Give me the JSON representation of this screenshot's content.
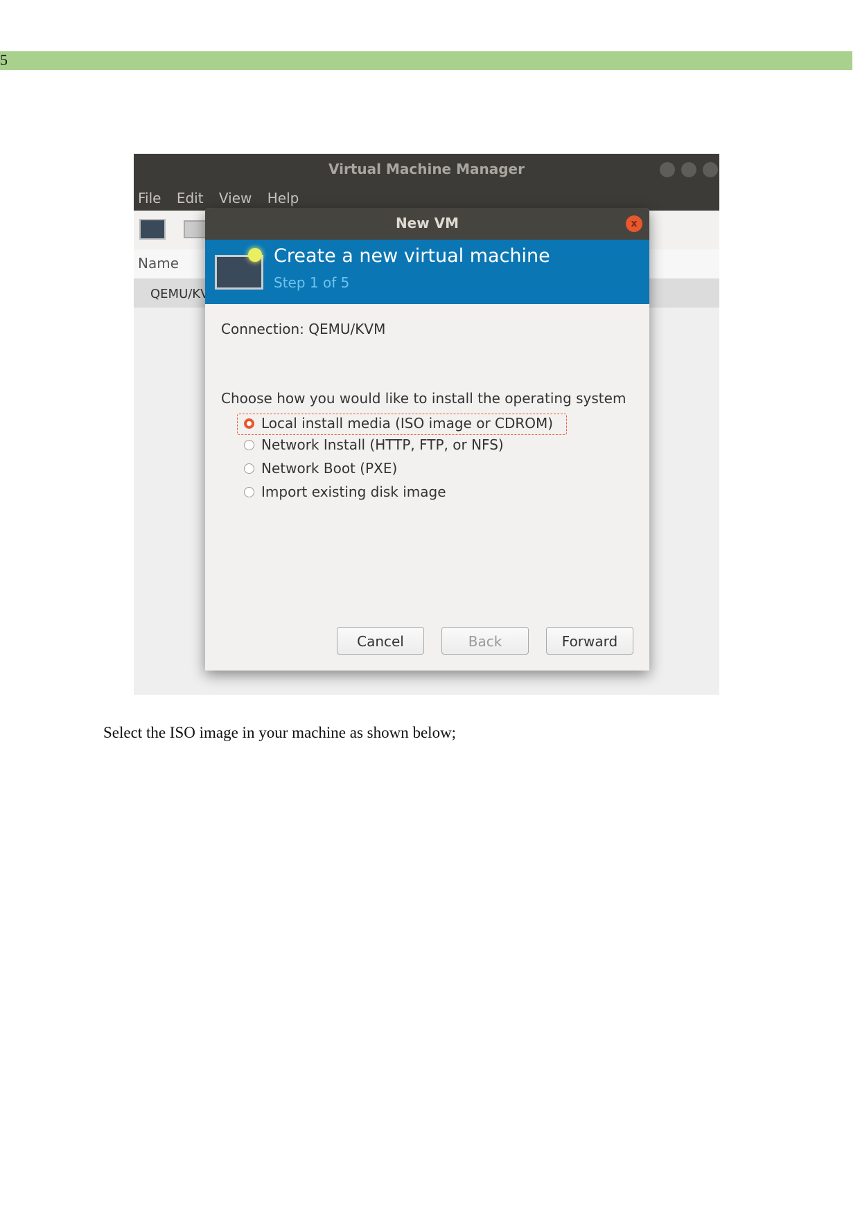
{
  "page_number": "5",
  "window": {
    "title": "Virtual Machine Manager",
    "menu": [
      "File",
      "Edit",
      "View",
      "Help"
    ],
    "list_header": "Name",
    "list_row": "QEMU/KVM"
  },
  "dialog": {
    "title": "New VM",
    "close": "x",
    "heading": "Create a new virtual machine",
    "step": "Step 1 of 5",
    "connection": "Connection:  QEMU/KVM",
    "prompt": "Choose how you would like to install the operating system",
    "options": [
      "Local install media (ISO image or CDROM)",
      "Network Install (HTTP, FTP, or NFS)",
      "Network Boot (PXE)",
      "Import existing disk image"
    ],
    "selected_option": 0,
    "buttons": {
      "cancel": "Cancel",
      "back": "Back",
      "forward": "Forward"
    }
  },
  "caption": "Select the ISO image in your machine as shown below;",
  "colors": {
    "band": "#a9d18e",
    "header_blue": "#0b76b4",
    "accent": "#e8582c"
  }
}
